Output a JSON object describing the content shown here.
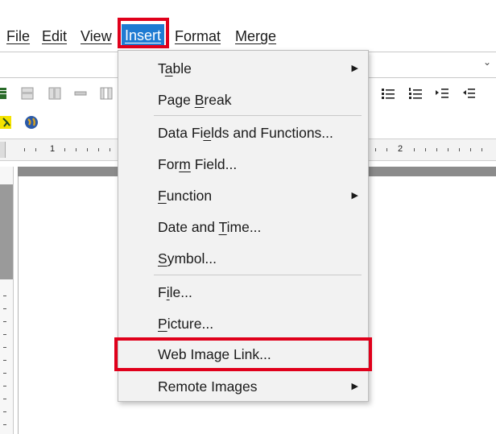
{
  "menubar": {
    "items": [
      {
        "label": "File"
      },
      {
        "label": "Edit"
      },
      {
        "label": "View"
      },
      {
        "label": "Insert"
      },
      {
        "label": "Format"
      },
      {
        "label": "Merge"
      }
    ]
  },
  "ruler": {
    "labels": [
      "1",
      "2"
    ]
  },
  "insert_menu": {
    "items": [
      {
        "pre": "T",
        "key": "a",
        "post": "ble",
        "submenu": true
      },
      {
        "pre": "Page ",
        "key": "B",
        "post": "reak",
        "submenu": false
      },
      {
        "pre": "Data Fi",
        "key": "e",
        "post": "lds and Functions...",
        "submenu": false
      },
      {
        "pre": "For",
        "key": "m",
        "post": " Field...",
        "submenu": false
      },
      {
        "pre": "",
        "key": "F",
        "post": "unction",
        "submenu": true
      },
      {
        "pre": "Date and ",
        "key": "T",
        "post": "ime...",
        "submenu": false
      },
      {
        "pre": "",
        "key": "S",
        "post": "ymbol...",
        "submenu": false
      },
      {
        "pre": "F",
        "key": "i",
        "post": "le...",
        "submenu": false
      },
      {
        "pre": "",
        "key": "P",
        "post": "icture...",
        "submenu": false
      },
      {
        "pre": "Web Image Link...",
        "key": "",
        "post": "",
        "submenu": false
      },
      {
        "pre": "Remote Images",
        "key": "",
        "post": "",
        "submenu": true
      }
    ]
  },
  "colors": {
    "highlight": "#e0001b",
    "active_menu": "#1e7bd2"
  }
}
